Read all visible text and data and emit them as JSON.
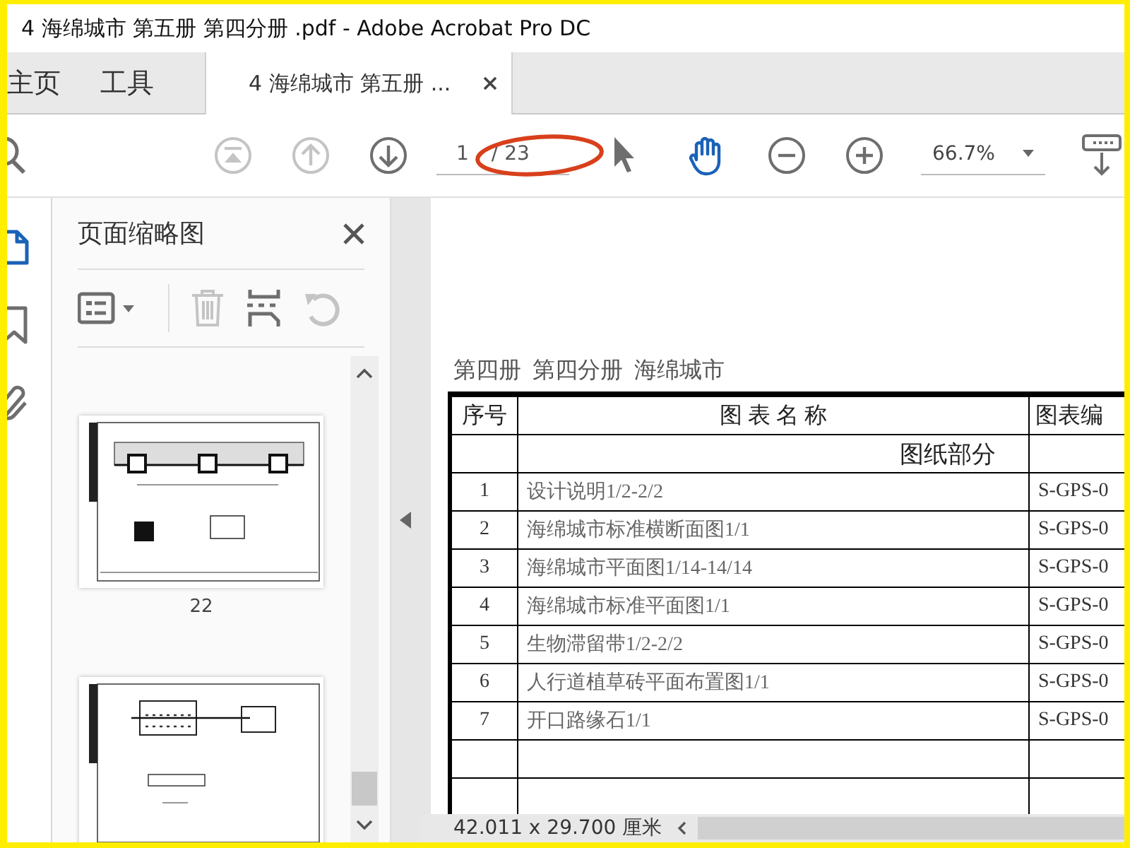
{
  "window": {
    "title": "4 海绵城市 第五册 第四分册 .pdf - Adobe Acrobat Pro DC"
  },
  "tabs": [
    {
      "label": "主页",
      "selected": false
    },
    {
      "label": "工具",
      "selected": false
    },
    {
      "label": "4 海绵城市 第五册 ...",
      "selected": true
    }
  ],
  "toolbar": {
    "page_number": "1",
    "page_total": "/ 23",
    "zoom": "66.7%",
    "nav": [
      {
        "kind": "first",
        "disabled": true
      },
      {
        "kind": "prev",
        "disabled": true
      },
      {
        "kind": "next",
        "disabled": false
      }
    ],
    "tools": [
      {
        "kind": "select",
        "selected": false
      },
      {
        "kind": "hand",
        "selected": true
      }
    ]
  },
  "side_rail": [
    {
      "kind": "pages",
      "selected": true
    },
    {
      "kind": "bookmarks",
      "selected": false
    },
    {
      "kind": "attachments",
      "selected": false
    }
  ],
  "thumbnail_panel": {
    "title": "页面缩略图",
    "tools": [
      {
        "kind": "options",
        "disabled": false
      },
      {
        "kind": "delete",
        "disabled": true
      },
      {
        "kind": "insert",
        "disabled": false
      },
      {
        "kind": "rotate",
        "disabled": true
      }
    ],
    "thumbnails": [
      {
        "kind": "sections",
        "page_label": "22"
      },
      {
        "kind": "elevations"
      }
    ]
  },
  "document": {
    "heading": "第四册  第四分册  海绵城市",
    "columns": [
      "序号",
      "图 表 名 称",
      "图表编"
    ],
    "section": "图纸部分",
    "rows": [
      {
        "no": "1",
        "name": "设计说明1/2-2/2",
        "code": "S-GPS-0"
      },
      {
        "no": "2",
        "name": "海绵城市标准横断面图1/1",
        "code": "S-GPS-0"
      },
      {
        "no": "3",
        "name": "海绵城市平面图1/14-14/14",
        "code": "S-GPS-0"
      },
      {
        "no": "4",
        "name": "海绵城市标准平面图1/1",
        "code": "S-GPS-0"
      },
      {
        "no": "5",
        "name": "生物滞留带1/2-2/2",
        "code": "S-GPS-0"
      },
      {
        "no": "6",
        "name": "人行道植草砖平面布置图1/1",
        "code": "S-GPS-0"
      },
      {
        "no": "7",
        "name": "开口路缘石1/1",
        "code": "S-GPS-0"
      }
    ]
  },
  "status_bar": {
    "page_size": "42.011 x 29.700 厘米"
  }
}
